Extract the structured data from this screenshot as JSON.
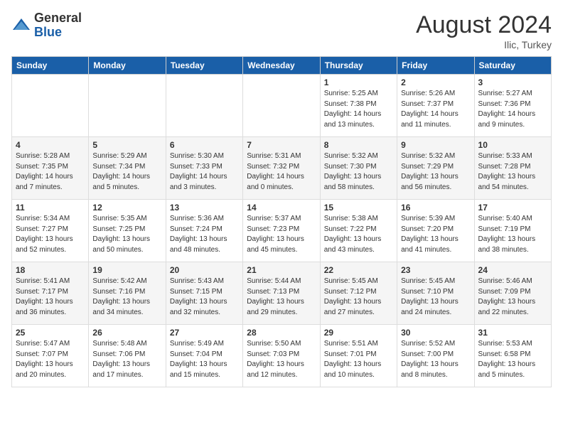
{
  "header": {
    "logo_general": "General",
    "logo_blue": "Blue",
    "month_year": "August 2024",
    "location": "Ilic, Turkey"
  },
  "weekdays": [
    "Sunday",
    "Monday",
    "Tuesday",
    "Wednesday",
    "Thursday",
    "Friday",
    "Saturday"
  ],
  "weeks": [
    [
      {
        "day": "",
        "info": ""
      },
      {
        "day": "",
        "info": ""
      },
      {
        "day": "",
        "info": ""
      },
      {
        "day": "",
        "info": ""
      },
      {
        "day": "1",
        "info": "Sunrise: 5:25 AM\nSunset: 7:38 PM\nDaylight: 14 hours\nand 13 minutes."
      },
      {
        "day": "2",
        "info": "Sunrise: 5:26 AM\nSunset: 7:37 PM\nDaylight: 14 hours\nand 11 minutes."
      },
      {
        "day": "3",
        "info": "Sunrise: 5:27 AM\nSunset: 7:36 PM\nDaylight: 14 hours\nand 9 minutes."
      }
    ],
    [
      {
        "day": "4",
        "info": "Sunrise: 5:28 AM\nSunset: 7:35 PM\nDaylight: 14 hours\nand 7 minutes."
      },
      {
        "day": "5",
        "info": "Sunrise: 5:29 AM\nSunset: 7:34 PM\nDaylight: 14 hours\nand 5 minutes."
      },
      {
        "day": "6",
        "info": "Sunrise: 5:30 AM\nSunset: 7:33 PM\nDaylight: 14 hours\nand 3 minutes."
      },
      {
        "day": "7",
        "info": "Sunrise: 5:31 AM\nSunset: 7:32 PM\nDaylight: 14 hours\nand 0 minutes."
      },
      {
        "day": "8",
        "info": "Sunrise: 5:32 AM\nSunset: 7:30 PM\nDaylight: 13 hours\nand 58 minutes."
      },
      {
        "day": "9",
        "info": "Sunrise: 5:32 AM\nSunset: 7:29 PM\nDaylight: 13 hours\nand 56 minutes."
      },
      {
        "day": "10",
        "info": "Sunrise: 5:33 AM\nSunset: 7:28 PM\nDaylight: 13 hours\nand 54 minutes."
      }
    ],
    [
      {
        "day": "11",
        "info": "Sunrise: 5:34 AM\nSunset: 7:27 PM\nDaylight: 13 hours\nand 52 minutes."
      },
      {
        "day": "12",
        "info": "Sunrise: 5:35 AM\nSunset: 7:25 PM\nDaylight: 13 hours\nand 50 minutes."
      },
      {
        "day": "13",
        "info": "Sunrise: 5:36 AM\nSunset: 7:24 PM\nDaylight: 13 hours\nand 48 minutes."
      },
      {
        "day": "14",
        "info": "Sunrise: 5:37 AM\nSunset: 7:23 PM\nDaylight: 13 hours\nand 45 minutes."
      },
      {
        "day": "15",
        "info": "Sunrise: 5:38 AM\nSunset: 7:22 PM\nDaylight: 13 hours\nand 43 minutes."
      },
      {
        "day": "16",
        "info": "Sunrise: 5:39 AM\nSunset: 7:20 PM\nDaylight: 13 hours\nand 41 minutes."
      },
      {
        "day": "17",
        "info": "Sunrise: 5:40 AM\nSunset: 7:19 PM\nDaylight: 13 hours\nand 38 minutes."
      }
    ],
    [
      {
        "day": "18",
        "info": "Sunrise: 5:41 AM\nSunset: 7:17 PM\nDaylight: 13 hours\nand 36 minutes."
      },
      {
        "day": "19",
        "info": "Sunrise: 5:42 AM\nSunset: 7:16 PM\nDaylight: 13 hours\nand 34 minutes."
      },
      {
        "day": "20",
        "info": "Sunrise: 5:43 AM\nSunset: 7:15 PM\nDaylight: 13 hours\nand 32 minutes."
      },
      {
        "day": "21",
        "info": "Sunrise: 5:44 AM\nSunset: 7:13 PM\nDaylight: 13 hours\nand 29 minutes."
      },
      {
        "day": "22",
        "info": "Sunrise: 5:45 AM\nSunset: 7:12 PM\nDaylight: 13 hours\nand 27 minutes."
      },
      {
        "day": "23",
        "info": "Sunrise: 5:45 AM\nSunset: 7:10 PM\nDaylight: 13 hours\nand 24 minutes."
      },
      {
        "day": "24",
        "info": "Sunrise: 5:46 AM\nSunset: 7:09 PM\nDaylight: 13 hours\nand 22 minutes."
      }
    ],
    [
      {
        "day": "25",
        "info": "Sunrise: 5:47 AM\nSunset: 7:07 PM\nDaylight: 13 hours\nand 20 minutes."
      },
      {
        "day": "26",
        "info": "Sunrise: 5:48 AM\nSunset: 7:06 PM\nDaylight: 13 hours\nand 17 minutes."
      },
      {
        "day": "27",
        "info": "Sunrise: 5:49 AM\nSunset: 7:04 PM\nDaylight: 13 hours\nand 15 minutes."
      },
      {
        "day": "28",
        "info": "Sunrise: 5:50 AM\nSunset: 7:03 PM\nDaylight: 13 hours\nand 12 minutes."
      },
      {
        "day": "29",
        "info": "Sunrise: 5:51 AM\nSunset: 7:01 PM\nDaylight: 13 hours\nand 10 minutes."
      },
      {
        "day": "30",
        "info": "Sunrise: 5:52 AM\nSunset: 7:00 PM\nDaylight: 13 hours\nand 8 minutes."
      },
      {
        "day": "31",
        "info": "Sunrise: 5:53 AM\nSunset: 6:58 PM\nDaylight: 13 hours\nand 5 minutes."
      }
    ]
  ]
}
